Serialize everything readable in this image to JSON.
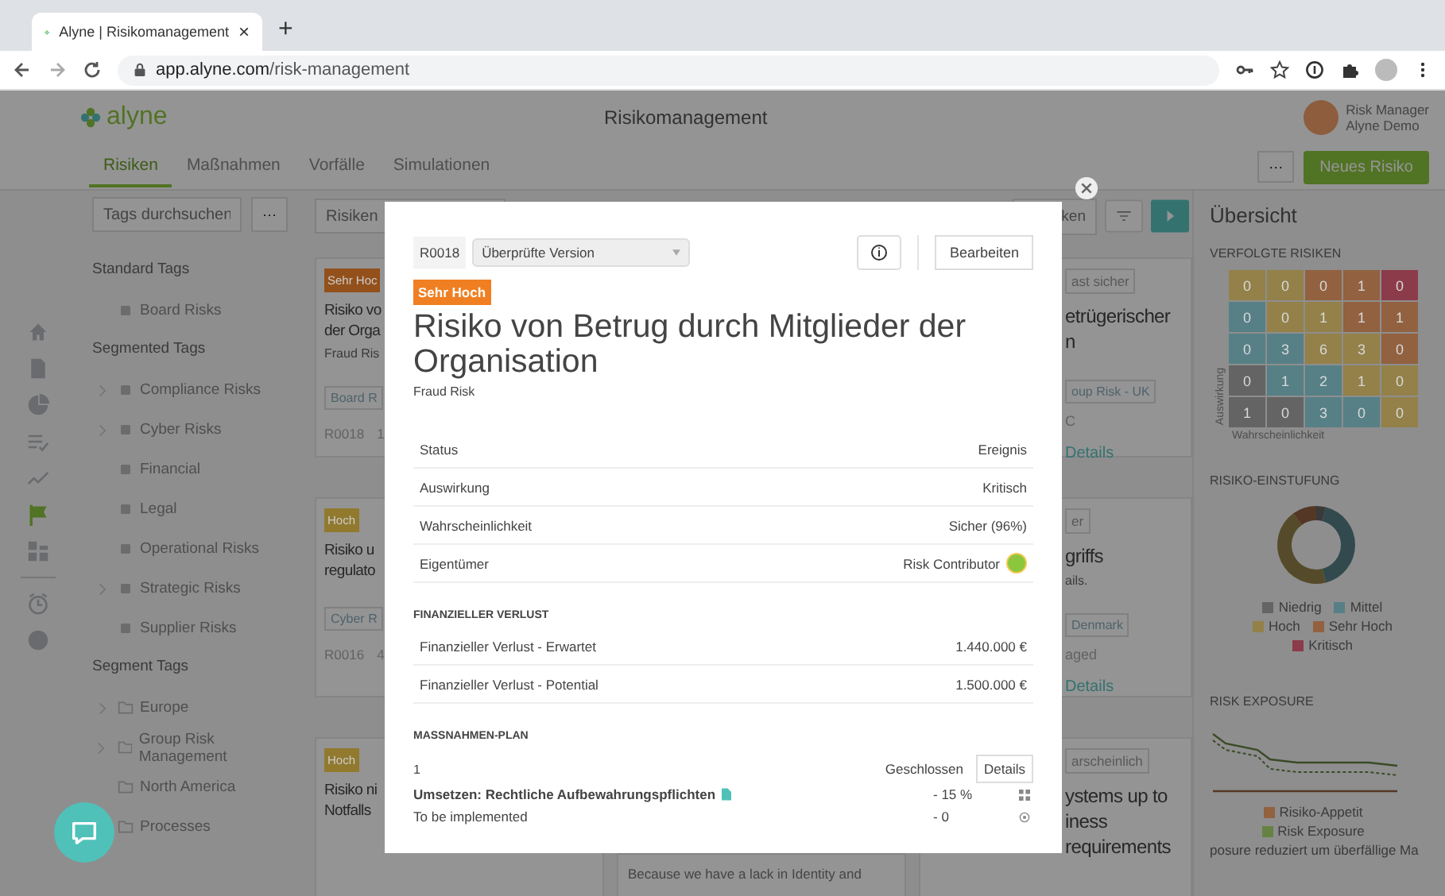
{
  "browser": {
    "tab_title": "Alyne | Risikomanagement",
    "tab_close": "×",
    "new_tab": "+",
    "url_host": "app.alyne.com",
    "url_path": "/risk-management"
  },
  "app": {
    "logo": "alyne",
    "title": "Risikomanagement",
    "user_name": "Risk Manager",
    "user_org": "Alyne Demo"
  },
  "nav": {
    "tabs": [
      {
        "label": "Risiken",
        "selected": true
      },
      {
        "label": "Maßnahmen",
        "selected": false
      },
      {
        "label": "Vorfälle",
        "selected": false
      },
      {
        "label": "Simulationen",
        "selected": false
      }
    ],
    "more": "···",
    "new_button": "Neues Risiko"
  },
  "rail": [
    {
      "selected": false
    },
    {
      "selected": false
    },
    {
      "selected": false
    },
    {
      "selected": false
    },
    {
      "selected": false
    },
    {
      "selected": true
    },
    {
      "selected": false
    },
    {
      "selected": false
    },
    {
      "selected": false
    }
  ],
  "tags": {
    "search_placeholder": "Tags durchsuchen",
    "more": "···",
    "groups": [
      {
        "title": "Standard Tags",
        "items": [
          {
            "label": "Board Risks",
            "has_children": false
          }
        ]
      },
      {
        "title": "Segmented Tags",
        "items": [
          {
            "label": "Compliance Risks",
            "has_children": true
          },
          {
            "label": "Cyber Risks",
            "has_children": true
          },
          {
            "label": "Financial",
            "has_children": false
          },
          {
            "label": "Legal",
            "has_children": false
          },
          {
            "label": "Operational Risks",
            "has_children": false
          },
          {
            "label": "Strategic Risks",
            "has_children": true
          },
          {
            "label": "Supplier Risks",
            "has_children": false
          }
        ]
      },
      {
        "title": "Segment Tags",
        "items": [
          {
            "label": "Europe",
            "has_children": true
          },
          {
            "label": "Group Risk Management",
            "has_children": true
          },
          {
            "label": "North America",
            "has_children": false
          },
          {
            "label": "Processes",
            "has_children": false
          }
        ]
      }
    ]
  },
  "toolbar": {
    "search_placeholder": "Risiken",
    "sort_button": "ken"
  },
  "cards_left": [
    {
      "rating": "Sehr Hoc",
      "color": "#93501a",
      "title_lines": [
        "Risiko vo",
        "der Orga"
      ],
      "subtitle": "Fraud Ris",
      "tag": "Board R",
      "id": "R0018",
      "extra": "1"
    },
    {
      "rating": "Hoch",
      "color": "#91792e",
      "title_lines": [
        "Risiko u",
        "regulato"
      ],
      "tag": "Cyber R",
      "id": "R0016",
      "extra": "4"
    },
    {
      "rating": "Hoch",
      "color": "#91792e",
      "title_lines": [
        "Risiko ni",
        "Notfalls"
      ]
    }
  ],
  "middle_text": "Because we have a lack in Identity and",
  "cards_right": [
    {
      "badge": "ast sicher",
      "title_lines": [
        "etrügerischer",
        "n"
      ],
      "tag": "oup Risk - UK",
      "meta": "C",
      "details": "Details"
    },
    {
      "badge": "er",
      "title_lines": [
        "griffs"
      ],
      "subtitle": "ails.",
      "tag": "Denmark",
      "meta": "aged",
      "details": "Details"
    },
    {
      "badge": "arscheinlich",
      "title_lines": [
        "ystems up to",
        "iness",
        "requirements"
      ]
    }
  ],
  "modal": {
    "id": "R0018",
    "version": "Überprüfte Version",
    "edit_button": "Bearbeiten",
    "rating": "Sehr Hoch",
    "title": "Risiko von Betrug durch Mitglieder der Organisation",
    "category": "Fraud Risk",
    "fields": [
      {
        "label": "Status",
        "value": "Ereignis",
        "avatar": false
      },
      {
        "label": "Auswirkung",
        "value": "Kritisch",
        "avatar": false
      },
      {
        "label": "Wahrscheinlichkeit",
        "value": "Sicher (96%)",
        "avatar": false
      },
      {
        "label": "Eigentümer",
        "value": "Risk Contributor",
        "avatar": true
      }
    ],
    "loss": {
      "heading": "FINANZIELLER VERLUST",
      "rows": [
        {
          "label": "Finanzieller Verlust - Erwartet",
          "value": "1.440.000 €"
        },
        {
          "label": "Finanzieller Verlust - Potential",
          "value": "1.500.000 €"
        }
      ]
    },
    "plan": {
      "heading": "MASSNAHMEN-PLAN",
      "number": "1",
      "status": "Geschlossen",
      "details": "Details",
      "items": [
        {
          "kind": "measure",
          "label": "Umsetzen: Rechtliche Aufbewahrungspflichten",
          "value": "- 15 %"
        },
        {
          "kind": "status",
          "label": "To be implemented",
          "value": "- 0"
        }
      ]
    }
  },
  "overview": {
    "title": "Übersicht",
    "heatmap": {
      "heading": "VERFOLGTE RISIKEN",
      "ylabel": "Auswirkung",
      "xlabel": "Wahrscheinlichkeit",
      "rows": [
        [
          {
            "value": "0",
            "color": "#938149"
          },
          {
            "value": "0",
            "color": "#938149"
          },
          {
            "value": "0",
            "color": "#926140"
          },
          {
            "value": "1",
            "color": "#926140"
          },
          {
            "value": "0",
            "color": "#8b3b49"
          }
        ],
        [
          {
            "value": "0",
            "color": "#568086"
          },
          {
            "value": "0",
            "color": "#938149"
          },
          {
            "value": "1",
            "color": "#938149"
          },
          {
            "value": "1",
            "color": "#926140"
          },
          {
            "value": "1",
            "color": "#926140"
          }
        ],
        [
          {
            "value": "0",
            "color": "#568086"
          },
          {
            "value": "3",
            "color": "#568086"
          },
          {
            "value": "6",
            "color": "#938149"
          },
          {
            "value": "3",
            "color": "#938149"
          },
          {
            "value": "0",
            "color": "#926140"
          }
        ],
        [
          {
            "value": "0",
            "color": "#646464"
          },
          {
            "value": "1",
            "color": "#568086"
          },
          {
            "value": "2",
            "color": "#568086"
          },
          {
            "value": "1",
            "color": "#938149"
          },
          {
            "value": "0",
            "color": "#938149"
          }
        ],
        [
          {
            "value": "1",
            "color": "#646464"
          },
          {
            "value": "0",
            "color": "#646464"
          },
          {
            "value": "3",
            "color": "#568086"
          },
          {
            "value": "0",
            "color": "#568086"
          },
          {
            "value": "0",
            "color": "#938149"
          }
        ]
      ]
    },
    "rating": {
      "heading": "RISIKO-EINSTUFUNG",
      "legend": [
        {
          "label": "Niedrig",
          "color": "#646464"
        },
        {
          "label": "Mittel",
          "color": "#568086"
        },
        {
          "label": "Hoch",
          "color": "#938149"
        },
        {
          "label": "Sehr Hoch",
          "color": "#926140"
        },
        {
          "label": "Kritisch",
          "color": "#8b3b49"
        }
      ]
    },
    "exposure": {
      "heading": "RISK EXPOSURE",
      "legend": [
        {
          "label": "Risiko-Appetit",
          "color": "#926140"
        },
        {
          "label": "Risk Exposure",
          "color": "#658242"
        }
      ],
      "note": "posure reduziert um überfällige Ma"
    }
  }
}
